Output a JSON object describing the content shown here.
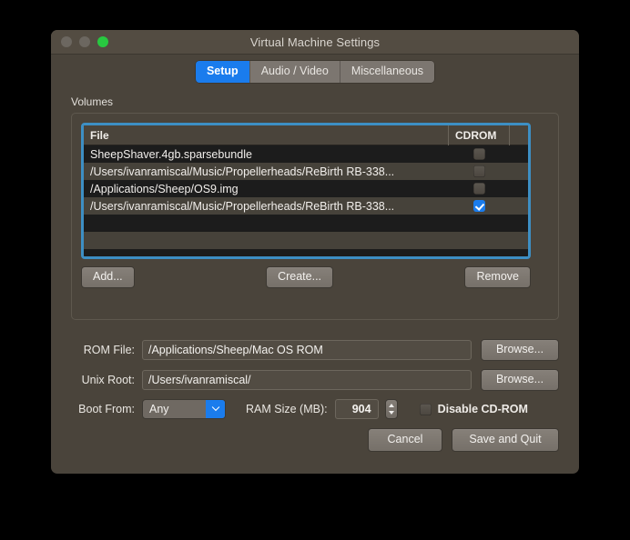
{
  "window": {
    "title": "Virtual Machine Settings",
    "traffic_lights": [
      "close-button",
      "minimize-button",
      "zoom-button"
    ],
    "accent_color": "#1a7ced",
    "focus_ring_color": "#3d8fc4",
    "background_color": "#4a443b"
  },
  "tabs": [
    {
      "label": "Setup",
      "active": true
    },
    {
      "label": "Audio / Video",
      "active": false
    },
    {
      "label": "Miscellaneous",
      "active": false
    }
  ],
  "volumes": {
    "group_label": "Volumes",
    "columns": [
      "File",
      "CDROM"
    ],
    "rows": [
      {
        "file": "SheepShaver.4gb.sparsebundle",
        "cdrom": false
      },
      {
        "file": "/Users/ivanramiscal/Music/Propellerheads/ReBirth RB-338...",
        "cdrom": false
      },
      {
        "file": "/Applications/Sheep/OS9.img",
        "cdrom": false
      },
      {
        "file": "/Users/ivanramiscal/Music/Propellerheads/ReBirth RB-338...",
        "cdrom": true
      }
    ],
    "empty_row_count": 3,
    "buttons": {
      "add": "Add...",
      "create": "Create...",
      "remove": "Remove"
    }
  },
  "form": {
    "rom_file": {
      "label": "ROM File:",
      "value": "/Applications/Sheep/Mac OS ROM",
      "browse": "Browse..."
    },
    "unix_root": {
      "label": "Unix Root:",
      "value": "/Users/ivanramiscal/",
      "browse": "Browse..."
    },
    "boot_from": {
      "label": "Boot From:",
      "value": "Any"
    },
    "ram_size": {
      "label": "RAM Size (MB):",
      "value": "904"
    },
    "disable_cdrom": {
      "label": "Disable CD-ROM",
      "checked": false
    }
  },
  "footer": {
    "cancel": "Cancel",
    "save": "Save and Quit"
  }
}
